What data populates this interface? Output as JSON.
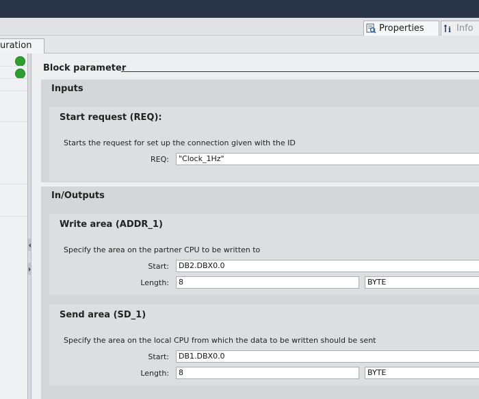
{
  "tabs": {
    "properties_label": "Properties",
    "info_label": "Info",
    "left_tab_label": "uration"
  },
  "main": {
    "heading": "Block parameter",
    "inputs": {
      "title": "Inputs",
      "start_request": {
        "title": "Start request (REQ):",
        "description": "Starts the request for set up the connection given with the ID",
        "req_label": "REQ:",
        "req_value": "\"Clock_1Hz\""
      }
    },
    "inoutputs": {
      "title": "In/Outputs",
      "write_area": {
        "title": "Write area (ADDR_1)",
        "description": "Specify the area on the partner CPU to be written to",
        "start_label": "Start:",
        "start_value": "DB2.DBX0.0",
        "length_label": "Length:",
        "length_value": "8",
        "type_value": "BYTE"
      },
      "send_area": {
        "title": "Send area (SD_1)",
        "description": "Specify the area on the local CPU from which the data to be written should be sent",
        "start_label": "Start:",
        "start_value": "DB1.DBX0.0",
        "length_label": "Length:",
        "length_value": "8",
        "type_value": "BYTE"
      }
    }
  },
  "icons": [
    "check-icon",
    "properties-icon",
    "info-icon",
    "collapse-left-icon",
    "expand-right-icon"
  ]
}
